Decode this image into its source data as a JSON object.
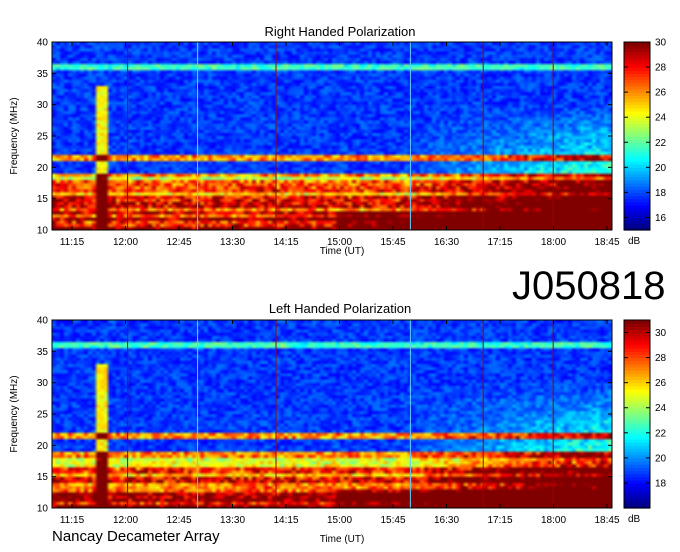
{
  "figure_id": "J050818",
  "footer": "Nancay Decameter Array",
  "chart_data": [
    {
      "type": "heatmap",
      "title": "Right Handed Polarization",
      "xlabel": "Time (UT)",
      "ylabel": "Frequency (MHz)",
      "x_ticks": [
        "11:15",
        "12:00",
        "12:45",
        "13:30",
        "14:15",
        "15:00",
        "15:45",
        "16:30",
        "17:15",
        "18:00",
        "18:45"
      ],
      "y_ticks": [
        10,
        15,
        20,
        25,
        30,
        35,
        40
      ],
      "ylim": [
        10,
        40
      ],
      "colorbar": {
        "label": "dB",
        "ticks": [
          16,
          18,
          20,
          22,
          24,
          26,
          28,
          30
        ],
        "range": [
          15,
          30
        ]
      },
      "colormap": [
        "#00008f",
        "#0000ff",
        "#00ffff",
        "#ffff00",
        "#ff0000",
        "#800000"
      ]
    },
    {
      "type": "heatmap",
      "title": "Left Handed Polarization",
      "xlabel": "Time (UT)",
      "ylabel": "Frequency (MHz)",
      "x_ticks": [
        "11:15",
        "12:00",
        "12:45",
        "13:30",
        "14:15",
        "15:00",
        "15:45",
        "16:30",
        "17:15",
        "18:00",
        "18:45"
      ],
      "y_ticks": [
        10,
        15,
        20,
        25,
        30,
        35,
        40
      ],
      "ylim": [
        10,
        40
      ],
      "colorbar": {
        "label": "dB",
        "ticks": [
          18,
          20,
          22,
          24,
          26,
          28,
          30
        ],
        "range": [
          16,
          31
        ]
      },
      "colormap": [
        "#00008f",
        "#0000ff",
        "#00ffff",
        "#ffff00",
        "#ff0000",
        "#800000"
      ]
    }
  ]
}
